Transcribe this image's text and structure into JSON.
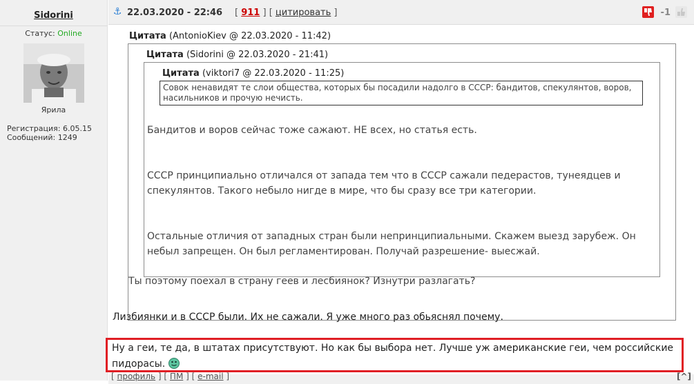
{
  "author": {
    "name": "Sidorini",
    "status_label": "Статус:",
    "status_value": "Online",
    "rank": "Ярила",
    "registration": "Регистрация: 6.05.15",
    "messages": "Сообщений: 1249"
  },
  "header": {
    "date": "22.03.2020 - 22:46",
    "post_number": "911",
    "quote_link": "цитировать",
    "score": "-1"
  },
  "quotes": {
    "level1_label_bold": "Цитата",
    "level1_label_meta": "(AntonioKiev @ 22.03.2020 - 11:42)",
    "level2_label_bold": "Цитата",
    "level2_label_meta": "(Sidorini @ 22.03.2020 - 21:41)",
    "level3_label_bold": "Цитата",
    "level3_label_meta": "(viktori7 @ 22.03.2020 - 11:25)",
    "level3_text": "Совок ненавидят те слои общества, которых бы посадили надолго в СССР: бандитов, спекулянтов, воров, насильников и прочую нечисть.",
    "level2_paragraphs": [
      "Бандитов и воров сейчас тоже сажают. НЕ всех, но статья есть.",
      "СССР принципиально отличался от запада тем что в СССР сажали педерастов, тунеядцев и спекулянтов. Такого небыло нигде в мире, что бы сразу все три категории.",
      "Остальные отличия от западных стран были непринципиальными. Скажем выезд зарубеж. Он небыл запрещен. Он был регламентирован. Получай разрешение- выесжай."
    ],
    "level1_reply": "Ты поэтому поехал в страну геев и лесбиянок? Изнутри разлагать?"
  },
  "reply": {
    "line1": "Лизбиянки и в СССР были. Их не сажали. Я уже много раз обьяснял почему.",
    "highlighted": "Ну а геи, те да, в штатах присутствуют. Но как бы выбора нет. Лучше уж американские геи, чем российские пидорасы."
  },
  "footer": {
    "profile": "профиль",
    "pm": "ПМ",
    "email": "e-mail",
    "top": "[^]"
  },
  "icons": {
    "anchor": "anchor-icon",
    "vote_down": "thumbs-down-icon",
    "vote_up": "thumbs-up-icon",
    "smiley": "smiley-icon"
  },
  "colors": {
    "highlight_border": "#e01e24",
    "status_online": "#22aa22",
    "post_number": "#cc0000"
  }
}
